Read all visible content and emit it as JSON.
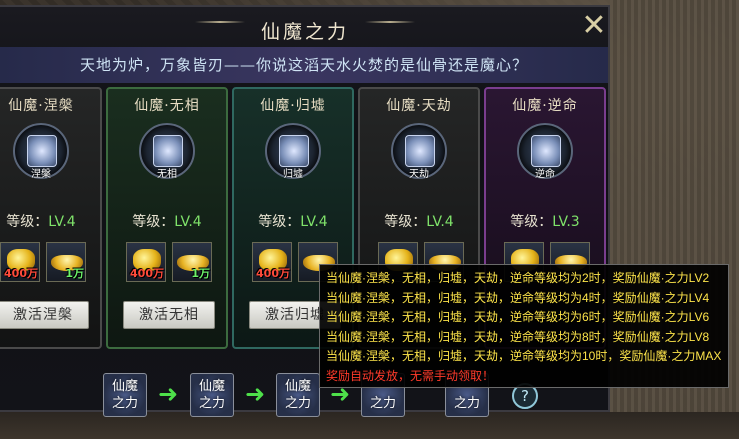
{
  "window": {
    "title": "仙魔之力",
    "close_icon": "x-cross-icon",
    "subtitle": "天地为炉，万象皆刃——你说这滔天水火焚的是仙骨还是魔心？"
  },
  "cards": [
    {
      "name": "仙魔·涅槃",
      "emblem_text": "涅槃",
      "level_label": "等级：",
      "level": "LV.4",
      "item1_count": "400万",
      "item2_count": "1万",
      "button": "激活涅槃"
    },
    {
      "name": "仙魔·无相",
      "emblem_text": "无相",
      "level_label": "等级：",
      "level": "LV.4",
      "item1_count": "400万",
      "item2_count": "1万",
      "button": "激活无相"
    },
    {
      "name": "仙魔·归墟",
      "emblem_text": "归墟",
      "level_label": "等级：",
      "level": "LV.4",
      "item1_count": "400万",
      "item2_count": "",
      "button": "激活归墟"
    },
    {
      "name": "仙魔·天劫",
      "emblem_text": "天劫",
      "level_label": "等级：",
      "level": "LV.4",
      "item1_count": "",
      "item2_count": "",
      "button": ""
    },
    {
      "name": "仙魔·逆命",
      "emblem_text": "逆命",
      "level_label": "等级：",
      "level": "LV.3",
      "item1_count": "",
      "item2_count": "",
      "button": ""
    }
  ],
  "item_icons": {
    "item1": "gold-coins-icon",
    "item2": "gold-ingot-icon"
  },
  "stages": [
    {
      "label_top": "仙魔",
      "label_bottom": "之力"
    },
    {
      "label_top": "仙魔",
      "label_bottom": "之力"
    },
    {
      "label_top": "仙魔",
      "label_bottom": "之力"
    },
    {
      "label_top": "",
      "label_bottom": "之力"
    },
    {
      "label_top": "",
      "label_bottom": "之力"
    }
  ],
  "help": {
    "icon": "question-icon",
    "label": "?"
  },
  "tooltip": {
    "lines": [
      "当仙魔·涅槃，无相，归墟，天劫，逆命等级均为2时，奖励仙魔·之力LV2",
      "当仙魔·涅槃，无相，归墟，天劫，逆命等级均为4时，奖励仙魔·之力LV4",
      "当仙魔·涅槃，无相，归墟，天劫，逆命等级均为6时，奖励仙魔·之力LV6",
      "当仙魔·涅槃，无相，归墟，天劫，逆命等级均为8时，奖励仙魔·之力LV8",
      "当仙魔·涅槃，无相，归墟，天劫，逆命等级均为10时，奖励仙魔·之力MAX"
    ],
    "notice": "奖励自动发放，无需手动领取！"
  },
  "colors": {
    "level_value": "#7fe26a",
    "tooltip_text": "#fde44a",
    "tooltip_notice": "#ff3a2a",
    "count_red": "#ff4a3a",
    "count_green": "#6cf26a"
  }
}
